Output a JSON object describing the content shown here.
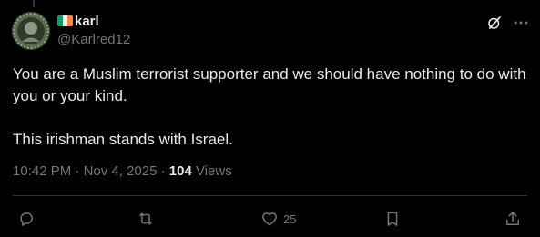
{
  "author": {
    "display_name": "karl",
    "handle": "@Karlred12",
    "flag_colors": [
      "#169b62",
      "#ffffff",
      "#ff883e"
    ]
  },
  "post": {
    "paragraphs": [
      "You are a Muslim terrorist supporter and we should have nothing to do with you or your kind.",
      "This irishman stands with Israel."
    ]
  },
  "meta": {
    "time": "10:42 PM",
    "separator": " · ",
    "date": "Nov 4, 2025",
    "views_count": "104",
    "views_label": " Views"
  },
  "actions": {
    "like_count": "25"
  },
  "icons": {
    "grok": "grok-slash-icon",
    "more": "more-horizontal-icon",
    "reply": "reply-icon",
    "repost": "repost-icon",
    "like": "heart-icon",
    "bookmark": "bookmark-icon",
    "share": "share-icon"
  },
  "colors": {
    "background": "#000000",
    "text": "#e7e9ea",
    "muted": "#71767b",
    "divider": "#2f3336"
  }
}
